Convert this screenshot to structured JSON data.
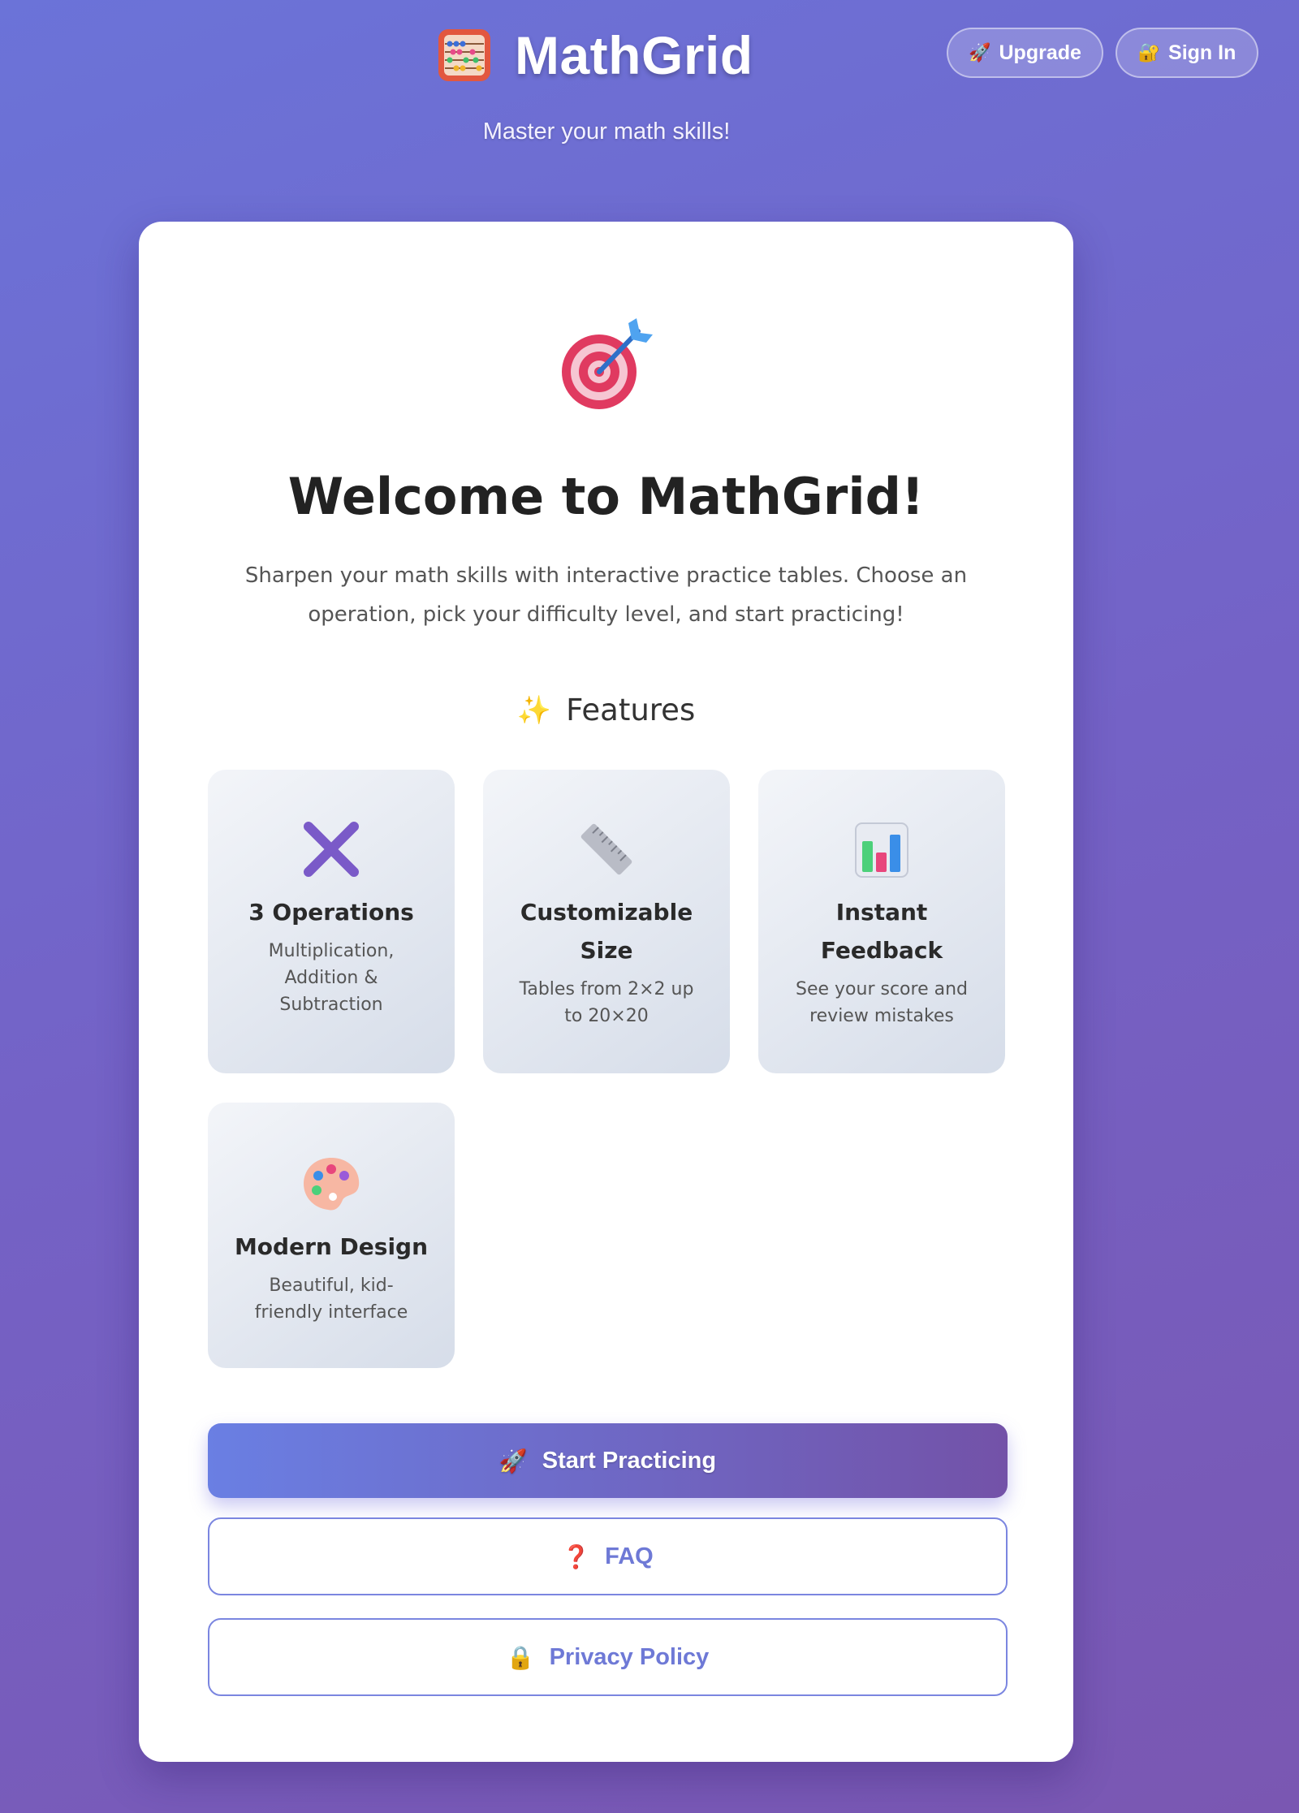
{
  "header": {
    "app_title": "MathGrid",
    "tagline": "Master your math skills!",
    "upgrade_label": "Upgrade",
    "signin_label": "Sign In",
    "upgrade_icon": "rocket-icon",
    "signin_icon": "lock-icon"
  },
  "welcome": {
    "title": "Welcome to MathGrid!",
    "intro": "Sharpen your math skills with interactive practice tables. Choose an operation, pick your difficulty level, and start practicing!"
  },
  "features": {
    "heading": "Features",
    "items": [
      {
        "title": "3 Operations",
        "description": "Multiplication, Addition & Subtraction",
        "icon": "multiply-icon"
      },
      {
        "title": "Customizable Size",
        "description": "Tables from 2×2 up to 20×20",
        "icon": "ruler-icon"
      },
      {
        "title": "Instant Feedback",
        "description": "See your score and review mistakes",
        "icon": "bar-chart-icon"
      },
      {
        "title": "Modern Design",
        "description": "Beautiful, kid-friendly interface",
        "icon": "palette-icon"
      }
    ]
  },
  "actions": {
    "start_label": "Start Practicing",
    "faq_label": "FAQ",
    "privacy_label": "Privacy Policy"
  },
  "colors": {
    "background_start": "#6b73d8",
    "background_end": "#7a57b2",
    "accent": "#6e79d6",
    "start_gradient_start": "#6a7fe3",
    "start_gradient_end": "#7352a8"
  }
}
